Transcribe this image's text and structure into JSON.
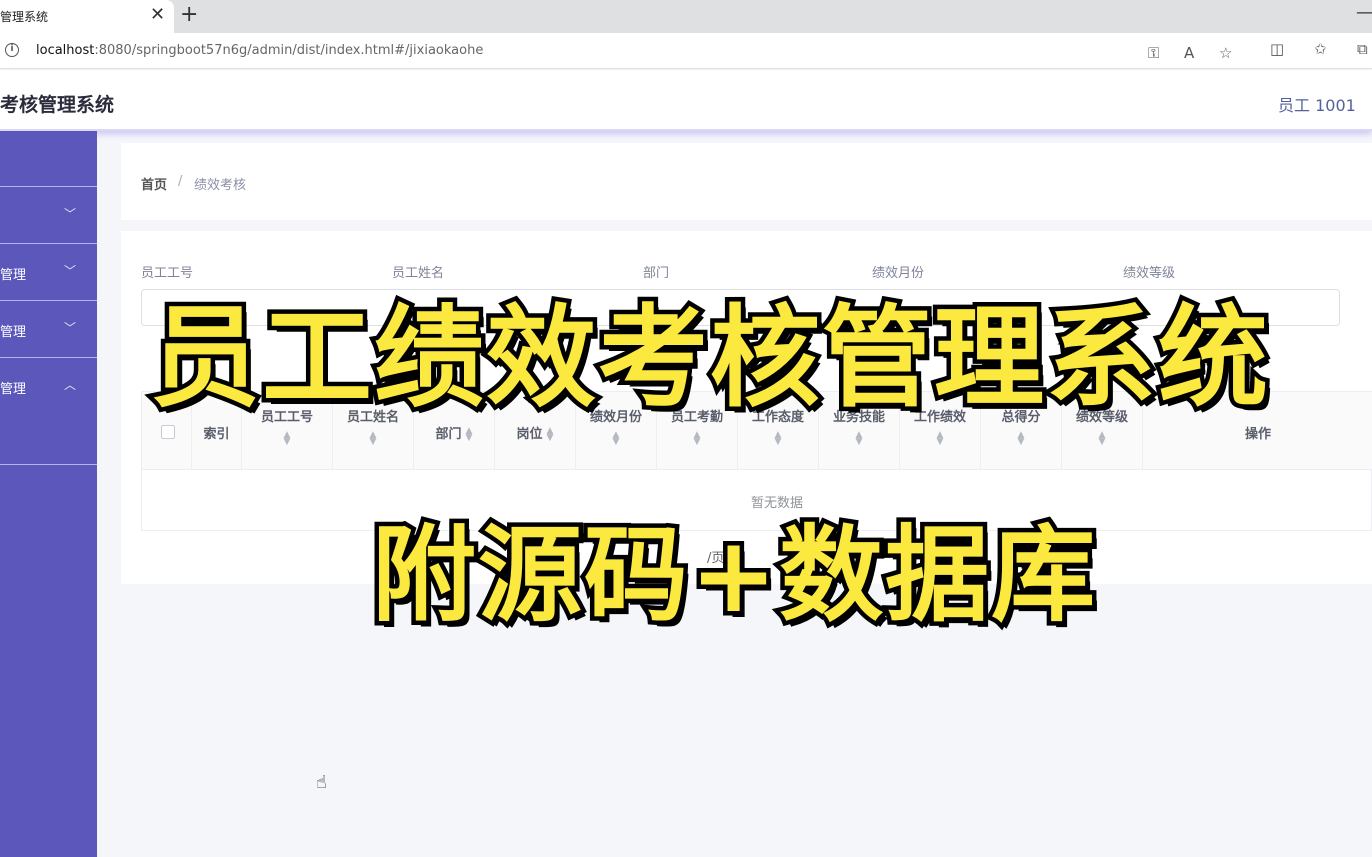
{
  "browser": {
    "tab_title": "管理系统",
    "tab_close": "✕",
    "new_tab": "+",
    "window_min": "—",
    "url_host": "localhost",
    "url_path": ":8080/springboot57n6g/admin/dist/index.html#/jixiaokaohe"
  },
  "header": {
    "title": "考核管理系统",
    "user": "员工 1001"
  },
  "sidebar": {
    "items": [
      {
        "label": "",
        "arrow": "﹀"
      },
      {
        "label": "管理",
        "arrow": "﹀"
      },
      {
        "label": "管理",
        "arrow": "﹀"
      },
      {
        "label": "管理",
        "arrow": "︿"
      }
    ]
  },
  "breadcrumb": {
    "home": "首页",
    "separator": "/",
    "current": "绩效考核"
  },
  "filters": {
    "labels": [
      "员工工号",
      "员工姓名",
      "部门",
      "绩效月份",
      "绩效等级"
    ]
  },
  "table": {
    "columns": [
      "索引",
      "员工工号",
      "员工姓名",
      "部门",
      "岗位",
      "绩效月份",
      "员工考勤",
      "工作态度",
      "业务技能",
      "工作绩效",
      "总得分",
      "绩效等级",
      "操作"
    ],
    "empty_text": "暂无数据"
  },
  "pagination": {
    "fragment": "/页"
  },
  "overlay": {
    "line1": "员工绩效考核管理系统",
    "line2": "附源码+数据库"
  }
}
